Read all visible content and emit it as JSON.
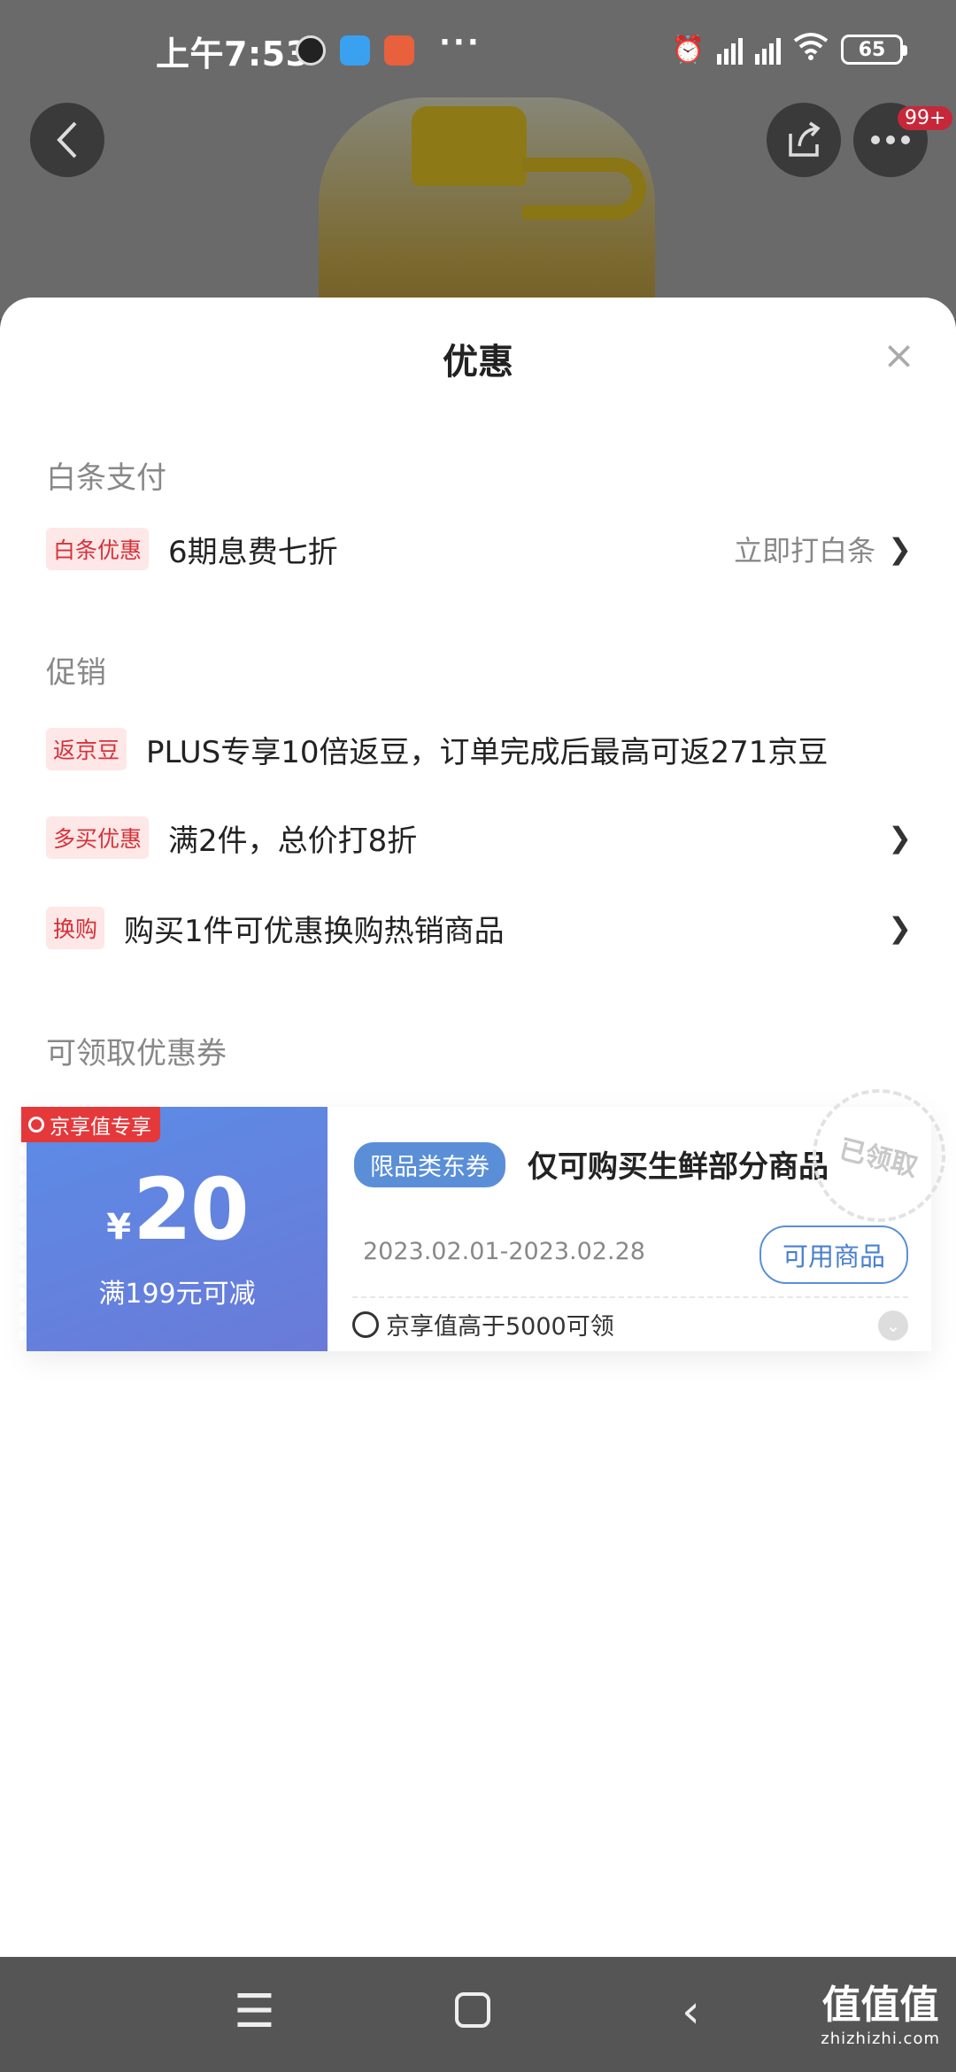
{
  "status_bar": {
    "time": "上午7:53",
    "more": "···",
    "battery": "65"
  },
  "product_page": {
    "cart_badge": "99+"
  },
  "sheet": {
    "title": "优惠",
    "close": "×",
    "baitiao": {
      "section_title": "白条支付",
      "tag": "白条优惠",
      "text": "6期息费七折",
      "action": "立即打白条"
    },
    "promotion": {
      "section_title": "促销",
      "items": [
        {
          "tag": "返京豆",
          "text": "PLUS专享10倍返豆，订单完成后最高可返271京豆"
        },
        {
          "tag": "多买优惠",
          "text": "满2件，总价打8折"
        },
        {
          "tag": "换购",
          "text": "购买1件可优惠换购热销商品"
        }
      ]
    },
    "coupons": {
      "section_title": "可领取优惠券",
      "items": [
        {
          "ribbon": "京享值专享",
          "currency": "¥",
          "amount": "20",
          "condition": "满199元可减",
          "type": "限品类东券",
          "description": "仅可购买生鲜部分商品",
          "date_range": "2023.02.01-2023.02.28",
          "button": "可用商品",
          "limit": "京享值高于5000可领",
          "stamp": "已领取"
        }
      ]
    }
  },
  "watermark": {
    "text": "值值值",
    "sub": "zhizhizhi.com"
  },
  "colors": {
    "accent_red": "#d6323a",
    "coupon_blue": "#5a8fd8",
    "tag_bg": "#fde7e7"
  }
}
